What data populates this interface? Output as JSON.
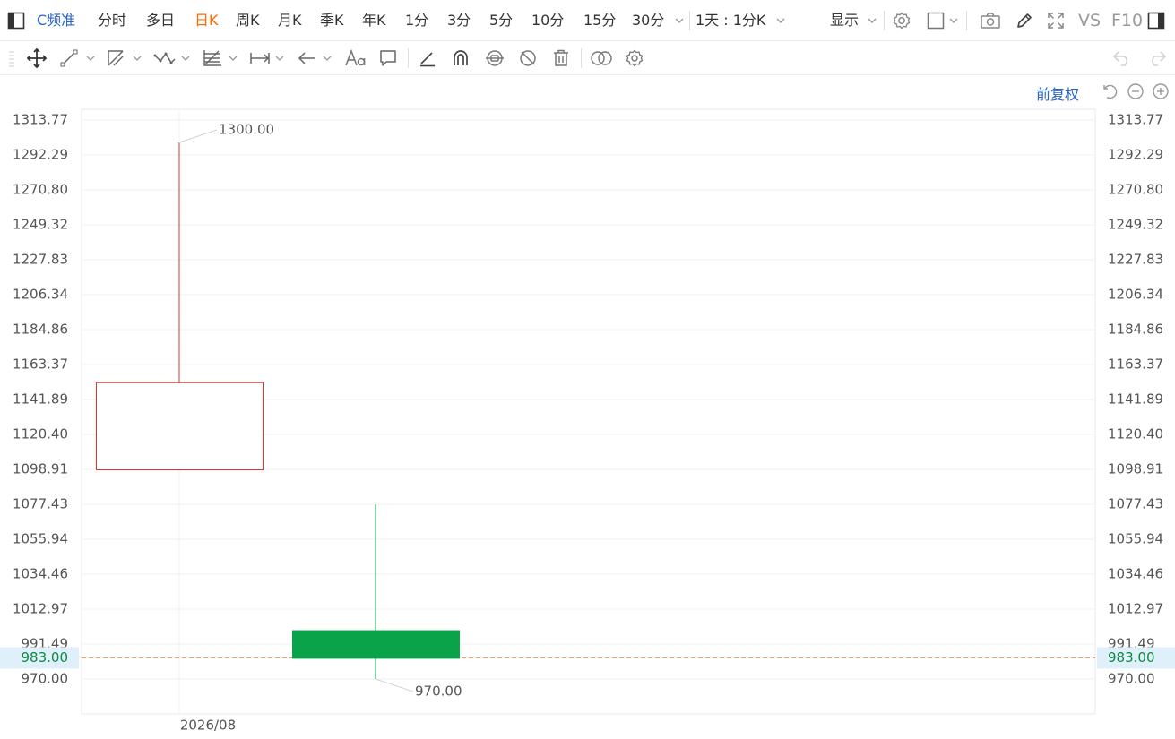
{
  "topbar": {
    "instrument": "C频准",
    "periods": [
      {
        "label": "分时",
        "active": false
      },
      {
        "label": "多日",
        "active": false
      },
      {
        "label": "日K",
        "active": true
      },
      {
        "label": "周K",
        "active": false
      },
      {
        "label": "月K",
        "active": false
      },
      {
        "label": "季K",
        "active": false
      },
      {
        "label": "年K",
        "active": false
      },
      {
        "label": "1分",
        "active": false
      },
      {
        "label": "3分",
        "active": false
      },
      {
        "label": "5分",
        "active": false
      },
      {
        "label": "10分",
        "active": false
      },
      {
        "label": "15分",
        "active": false
      }
    ],
    "more_period": "30分",
    "multi_period": "1天 : 1分K",
    "display_menu": "显示",
    "vs_label": "VS",
    "f10_label": "F10"
  },
  "chart_header": {
    "adjust_mode": "前复权"
  },
  "chart_data": {
    "type": "candlestick",
    "y_ticks": [
      "1313.77",
      "1292.29",
      "1270.80",
      "1249.32",
      "1227.83",
      "1206.34",
      "1184.86",
      "1163.37",
      "1141.89",
      "1120.40",
      "1098.91",
      "1077.43",
      "1055.94",
      "1034.46",
      "1012.97",
      "991.49",
      "970.00"
    ],
    "ylim": [
      970.0,
      1313.77
    ],
    "x_ticks": [
      "2026/08"
    ],
    "candles": [
      {
        "open": 1098.91,
        "close": 1152.5,
        "high": 1300.0,
        "low": 1098.91,
        "color": "#e0312b"
      },
      {
        "open": 1000.0,
        "close": 983.0,
        "high": 1077.43,
        "low": 970.0,
        "color": "#0aa34a"
      }
    ],
    "max_label": "1300.00",
    "min_label": "970.00",
    "last_price": "983.00",
    "colors": {
      "up": "#e0312b",
      "down": "#0aa34a",
      "last_line": "#e0905a",
      "last_bg": "#dff0fb",
      "grid": "#eef0f3"
    }
  }
}
